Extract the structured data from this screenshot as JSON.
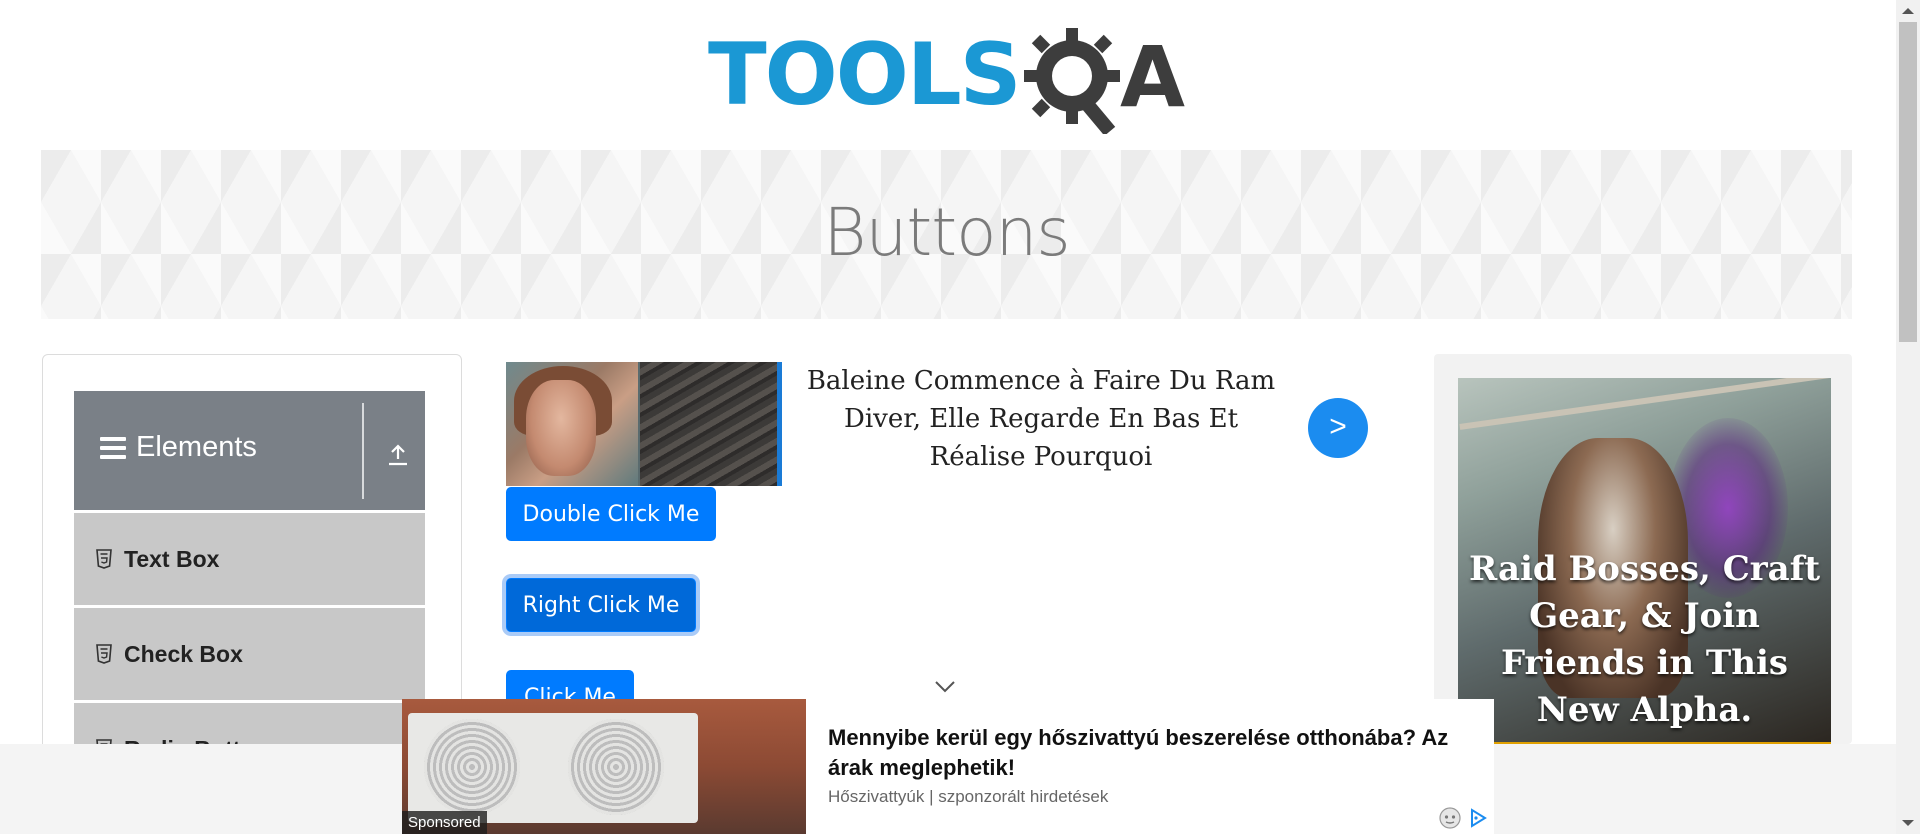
{
  "logo": {
    "text_primary": "TOOLS",
    "text_secondary": "A"
  },
  "banner": {
    "title": "Buttons"
  },
  "sidebar": {
    "group": {
      "label": "Elements"
    },
    "items": [
      {
        "label": "Text Box"
      },
      {
        "label": "Check Box"
      },
      {
        "label": "Radio Button"
      }
    ]
  },
  "ads": {
    "top": {
      "headline": "Baleine Commence à Faire Du Ram Diver, Elle Regarde En Bas Et Réalise Pourquoi",
      "arrow": ">"
    },
    "right": {
      "headline": "Raid Bosses, Craft Gear, & Join Friends in This New Alpha. Download Free!"
    },
    "bottom": {
      "title": "Mennyibe kerül egy hőszivattyú beszerelése otthonába? Az árak meglephetik!",
      "source": "Hőszivattyúk | szponzorált hirdetések",
      "sponsored": "Sponsored"
    }
  },
  "buttons": {
    "double_click": "Double Click Me",
    "right_click": "Right Click Me",
    "click": "Click Me"
  },
  "colors": {
    "primary": "#007bff",
    "logo_blue": "#1b98d4",
    "logo_dark": "#3d3d3d",
    "sidebar_header": "#7a8087",
    "sidebar_item": "#c8c8c8"
  },
  "icons": [
    "hamburger-icon",
    "upload-icon",
    "html5-icon",
    "gear-magnifier-icon",
    "chevron-down-icon",
    "adchoices-icon"
  ]
}
